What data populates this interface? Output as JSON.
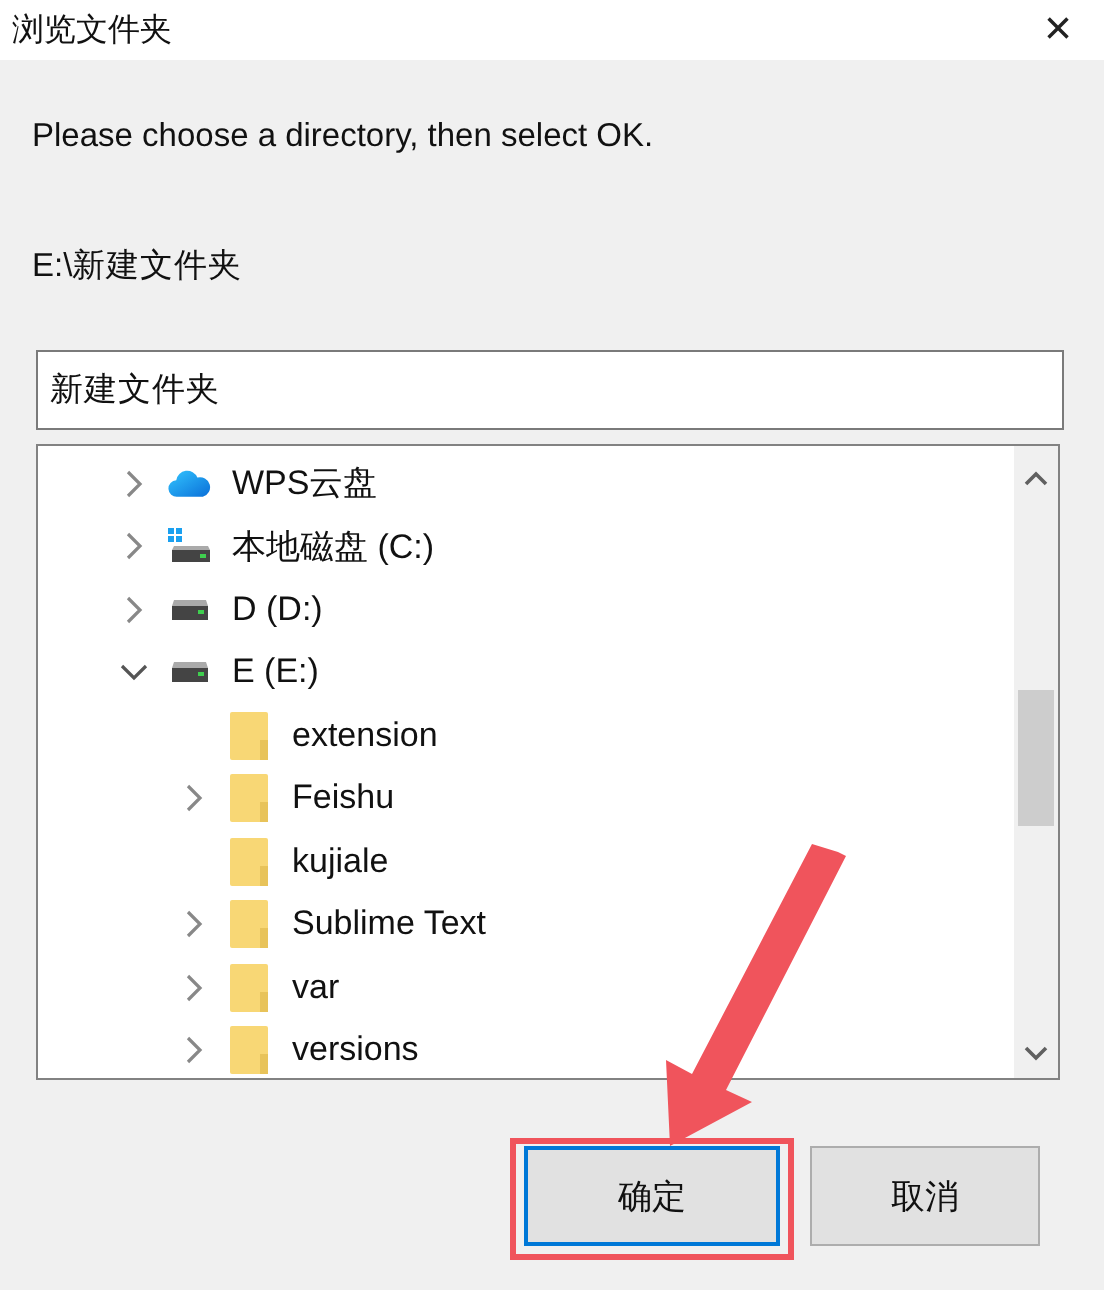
{
  "window": {
    "title": "浏览文件夹",
    "close": "×"
  },
  "prompt": "Please choose a directory, then select OK.",
  "path": "E:\\新建文件夹",
  "folder_field": {
    "value": "新建文件夹"
  },
  "tree": [
    {
      "label": "WPS云盘",
      "kind": "cloud",
      "expanded": false
    },
    {
      "label": "本地磁盘 (C:)",
      "kind": "system-drive",
      "expanded": false
    },
    {
      "label": "D (D:)",
      "kind": "drive",
      "expanded": false
    },
    {
      "label": "E (E:)",
      "kind": "drive",
      "expanded": true,
      "children": [
        {
          "label": "extension",
          "kind": "folder"
        },
        {
          "label": "Feishu",
          "kind": "folder",
          "expanded": false
        },
        {
          "label": "kujiale",
          "kind": "folder"
        },
        {
          "label": "Sublime Text",
          "kind": "folder",
          "expanded": false
        },
        {
          "label": "var",
          "kind": "folder",
          "expanded": false
        },
        {
          "label": "versions",
          "kind": "folder",
          "expanded": false
        }
      ]
    }
  ],
  "buttons": [
    {
      "label": "确定",
      "default": true
    },
    {
      "label": "取消",
      "default": false
    }
  ],
  "annotation": {
    "arrow": true,
    "highlight_box": true
  }
}
